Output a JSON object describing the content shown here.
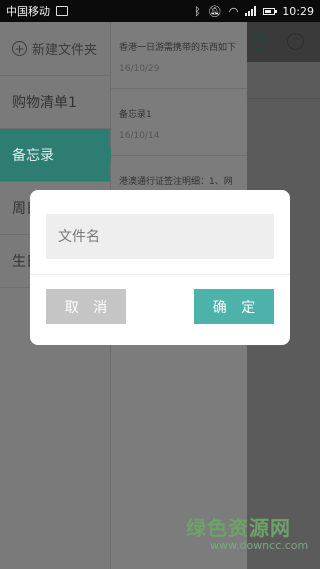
{
  "statusbar": {
    "carrier": "中国移动",
    "time": "10:29"
  },
  "sidebar": {
    "new_folder_label": "新建文件夹",
    "items": [
      {
        "label": "购物清单1"
      },
      {
        "label": "备忘录"
      },
      {
        "label": "周日"
      },
      {
        "label": "生日"
      }
    ]
  },
  "notes": [
    {
      "title": "香港一日游需携带的东西如下",
      "date": "16/10/29"
    },
    {
      "title": "备忘录1",
      "date": "16/10/14"
    },
    {
      "title": "港澳通行证签注明细：1、网",
      "date": ""
    }
  ],
  "dialog": {
    "input_placeholder": "文件名",
    "cancel_label": "取 消",
    "confirm_label": "确 定"
  },
  "watermark": {
    "title": "绿色资源网",
    "url": "www.downcc.com"
  },
  "colors": {
    "accent": "#4db3aa",
    "active_item": "#2e7d73",
    "cancel": "#c5c5c5"
  }
}
